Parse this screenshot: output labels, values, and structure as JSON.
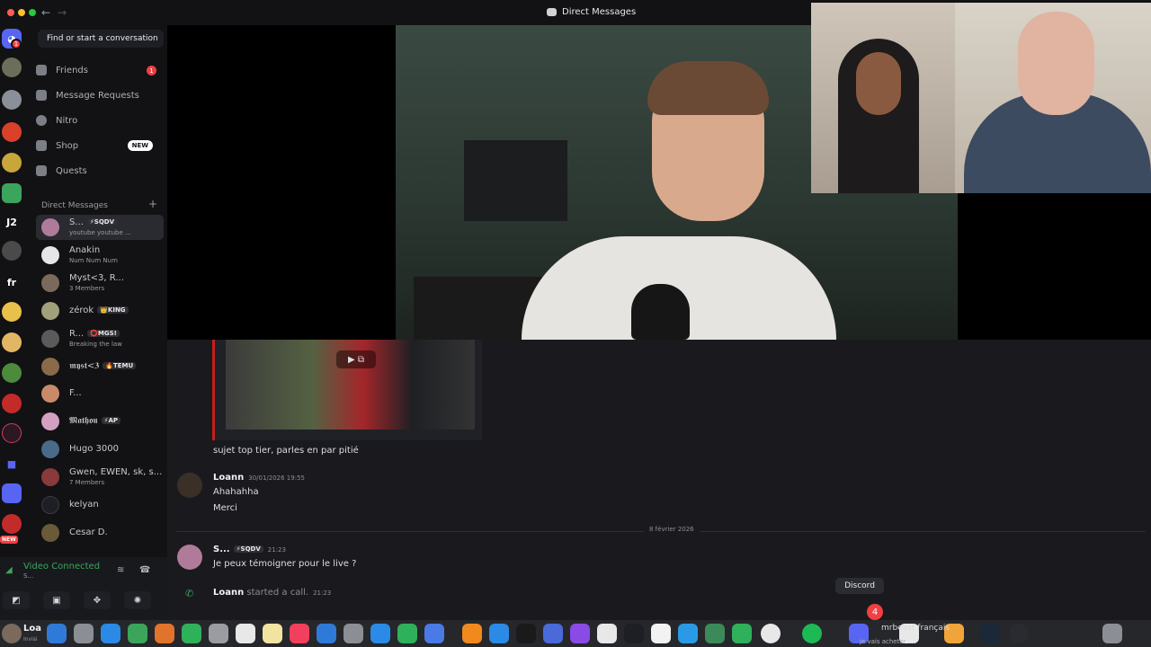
{
  "window": {
    "title": "Direct Messages"
  },
  "colors": {
    "accent": "#5865f2",
    "online": "#3ba55c",
    "badge": "#f23f43",
    "bg": "#1a1a1e",
    "sidebar": "#121214"
  },
  "rail": {
    "home_badge": "1",
    "labels": {
      "j2": "J2",
      "fr": "fr"
    },
    "new_label": "NEW"
  },
  "sidebar": {
    "search_label": "Find or start a conversation",
    "nav": [
      {
        "label": "Friends",
        "icon": "friends-icon",
        "badge": "1"
      },
      {
        "label": "Message Requests",
        "icon": "envelope-icon"
      },
      {
        "label": "Nitro",
        "icon": "nitro-icon"
      },
      {
        "label": "Shop",
        "icon": "shop-icon",
        "pill": "NEW"
      },
      {
        "label": "Quests",
        "icon": "quests-icon"
      }
    ],
    "dm_header": "Direct Messages",
    "dms": [
      {
        "name": "S...",
        "tag": "⚡SQDV",
        "sub": "youtube youtube ..."
      },
      {
        "name": "Anakin",
        "sub": "Num Num Num"
      },
      {
        "name": "Myst<3, R...",
        "sub": "3 Members"
      },
      {
        "name": "zérok",
        "tag": "👑KING"
      },
      {
        "name": "R...",
        "tag": "⭕MGS!",
        "sub": "Breaking the law"
      },
      {
        "name": "𝖒𝖞𝖘𝖙<𝟑",
        "tag": "🔥TEMU"
      },
      {
        "name": "F..."
      },
      {
        "name": "𝕸𝖆𝖙𝖍𝖔𝖚",
        "tag": "⚡AP"
      },
      {
        "name": "Hugo 3000"
      },
      {
        "name": "Gwen, EWEN, sk, s...",
        "sub": "7 Members"
      },
      {
        "name": "kelyan"
      },
      {
        "name": "Cesar D."
      }
    ]
  },
  "voice": {
    "title": "Video Connected",
    "sub": "S..."
  },
  "messages": {
    "m1_text": "sujet top tier, parles en par pitié",
    "m2_author": "Loann",
    "m2_time": "30/01/2026 19:55",
    "m2_line1": "Ahahahha",
    "m2_line2": "Merci",
    "date_divider": "8 février 2026",
    "m3_author": "S...",
    "m3_tag": "⚡SQDV",
    "m3_time": "21:23",
    "m3_text": "Je peux témoigner pour le live ?",
    "call_author": "Loann",
    "call_text": "started a call.",
    "call_time": "21:23"
  },
  "tooltip": "Discord",
  "dock": {
    "discord_badge": "4",
    "user_name": "Loa",
    "user_sub": "Invisi",
    "notif_text": "mrbeast français",
    "notif_sub": "je vais acheter ..."
  }
}
